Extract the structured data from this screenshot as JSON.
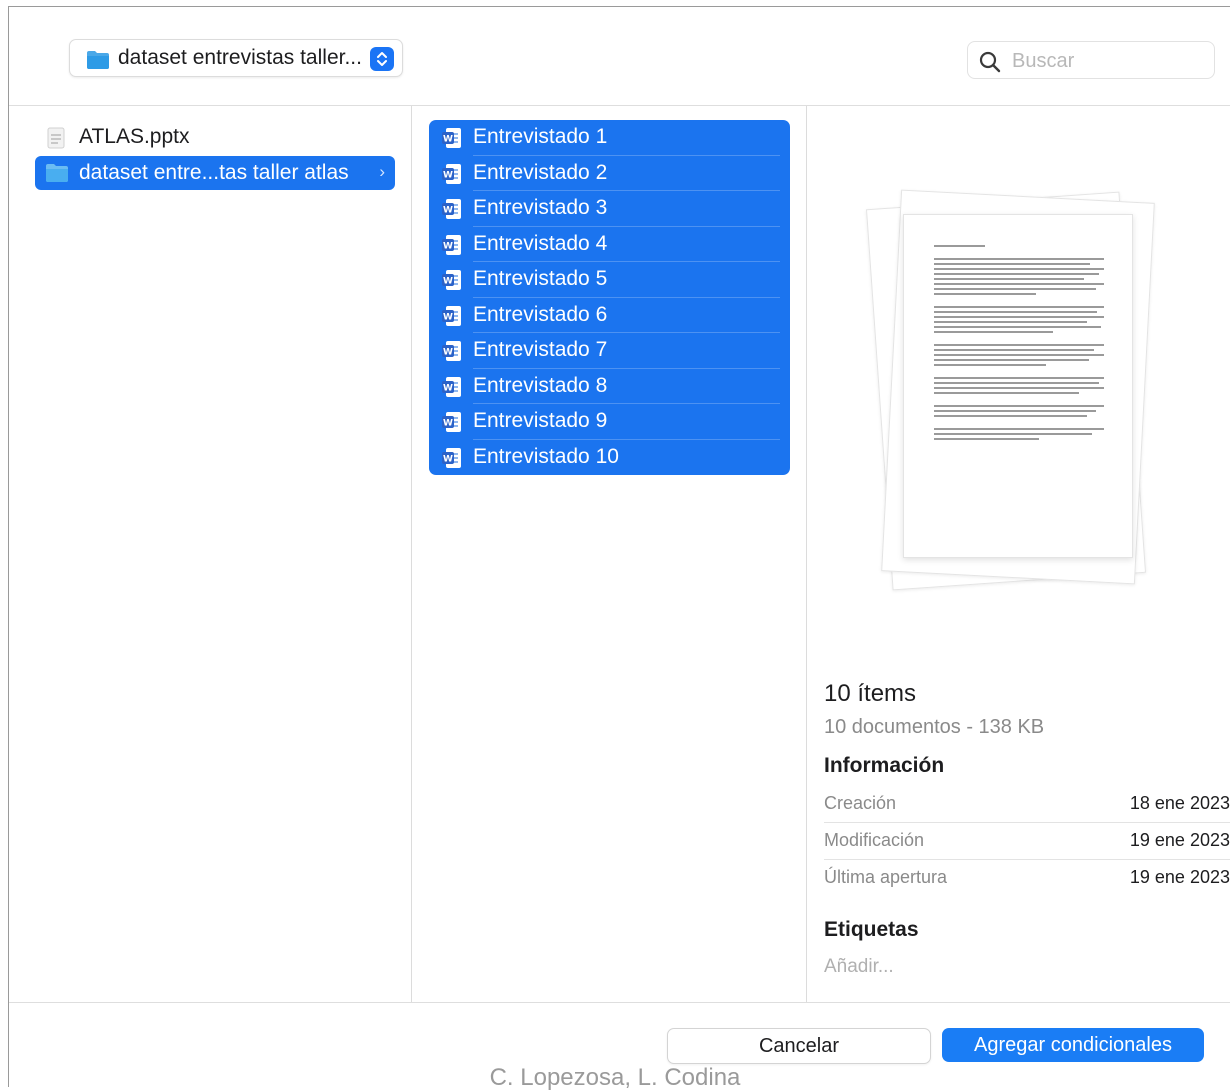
{
  "toolbar": {
    "folder_label": "dataset entrevistas taller...",
    "search_placeholder": "Buscar"
  },
  "sidebar": {
    "items": [
      {
        "label": "ATLAS.pptx",
        "icon": "pptx-file-icon",
        "selected": false
      },
      {
        "label": "dataset entre...tas taller atlas",
        "icon": "folder-icon",
        "selected": true,
        "chevron": "›"
      }
    ]
  },
  "files": {
    "items": [
      {
        "label": "Entrevistado 1",
        "icon": "word-doc-icon"
      },
      {
        "label": "Entrevistado 2",
        "icon": "word-doc-icon"
      },
      {
        "label": "Entrevistado 3",
        "icon": "word-doc-icon"
      },
      {
        "label": "Entrevistado 4",
        "icon": "word-doc-icon"
      },
      {
        "label": "Entrevistado 5",
        "icon": "word-doc-icon"
      },
      {
        "label": "Entrevistado 6",
        "icon": "word-doc-icon"
      },
      {
        "label": "Entrevistado 7",
        "icon": "word-doc-icon"
      },
      {
        "label": "Entrevistado 8",
        "icon": "word-doc-icon"
      },
      {
        "label": "Entrevistado 9",
        "icon": "word-doc-icon"
      },
      {
        "label": "Entrevistado 10",
        "icon": "word-doc-icon"
      }
    ]
  },
  "preview": {
    "count_title": "10 ítems",
    "summary": "10 documentos - 138 KB",
    "info_heading": "Información",
    "meta": [
      {
        "key": "Creación",
        "value": "18 ene 2023"
      },
      {
        "key": "Modificación",
        "value": "19 ene 2023"
      },
      {
        "key": "Última apertura",
        "value": "19 ene 2023"
      }
    ],
    "tags_heading": "Etiquetas",
    "tags_placeholder": "Añadir..."
  },
  "footer": {
    "cancel_label": "Cancelar",
    "confirm_label": "Agregar condicionales"
  },
  "caption": "C. Lopezosa, L. Codina",
  "colors": {
    "accent": "#1b74ef",
    "primary_button": "#1a7df5"
  }
}
